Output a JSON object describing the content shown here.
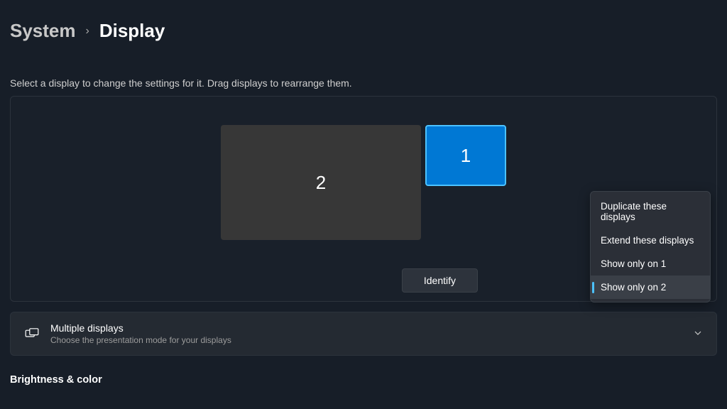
{
  "breadcrumb": {
    "parent": "System",
    "current": "Display"
  },
  "help_text": "Select a display to change the settings for it. Drag displays to rearrange them.",
  "displays": {
    "display1_label": "1",
    "display2_label": "2"
  },
  "identify_label": "Identify",
  "dropdown": {
    "option1": "Duplicate these displays",
    "option2": "Extend these displays",
    "option3": "Show only on 1",
    "option4": "Show only on 2"
  },
  "multiple_displays": {
    "title": "Multiple displays",
    "subtitle": "Choose the presentation mode for your displays"
  },
  "category": "Brightness & color"
}
